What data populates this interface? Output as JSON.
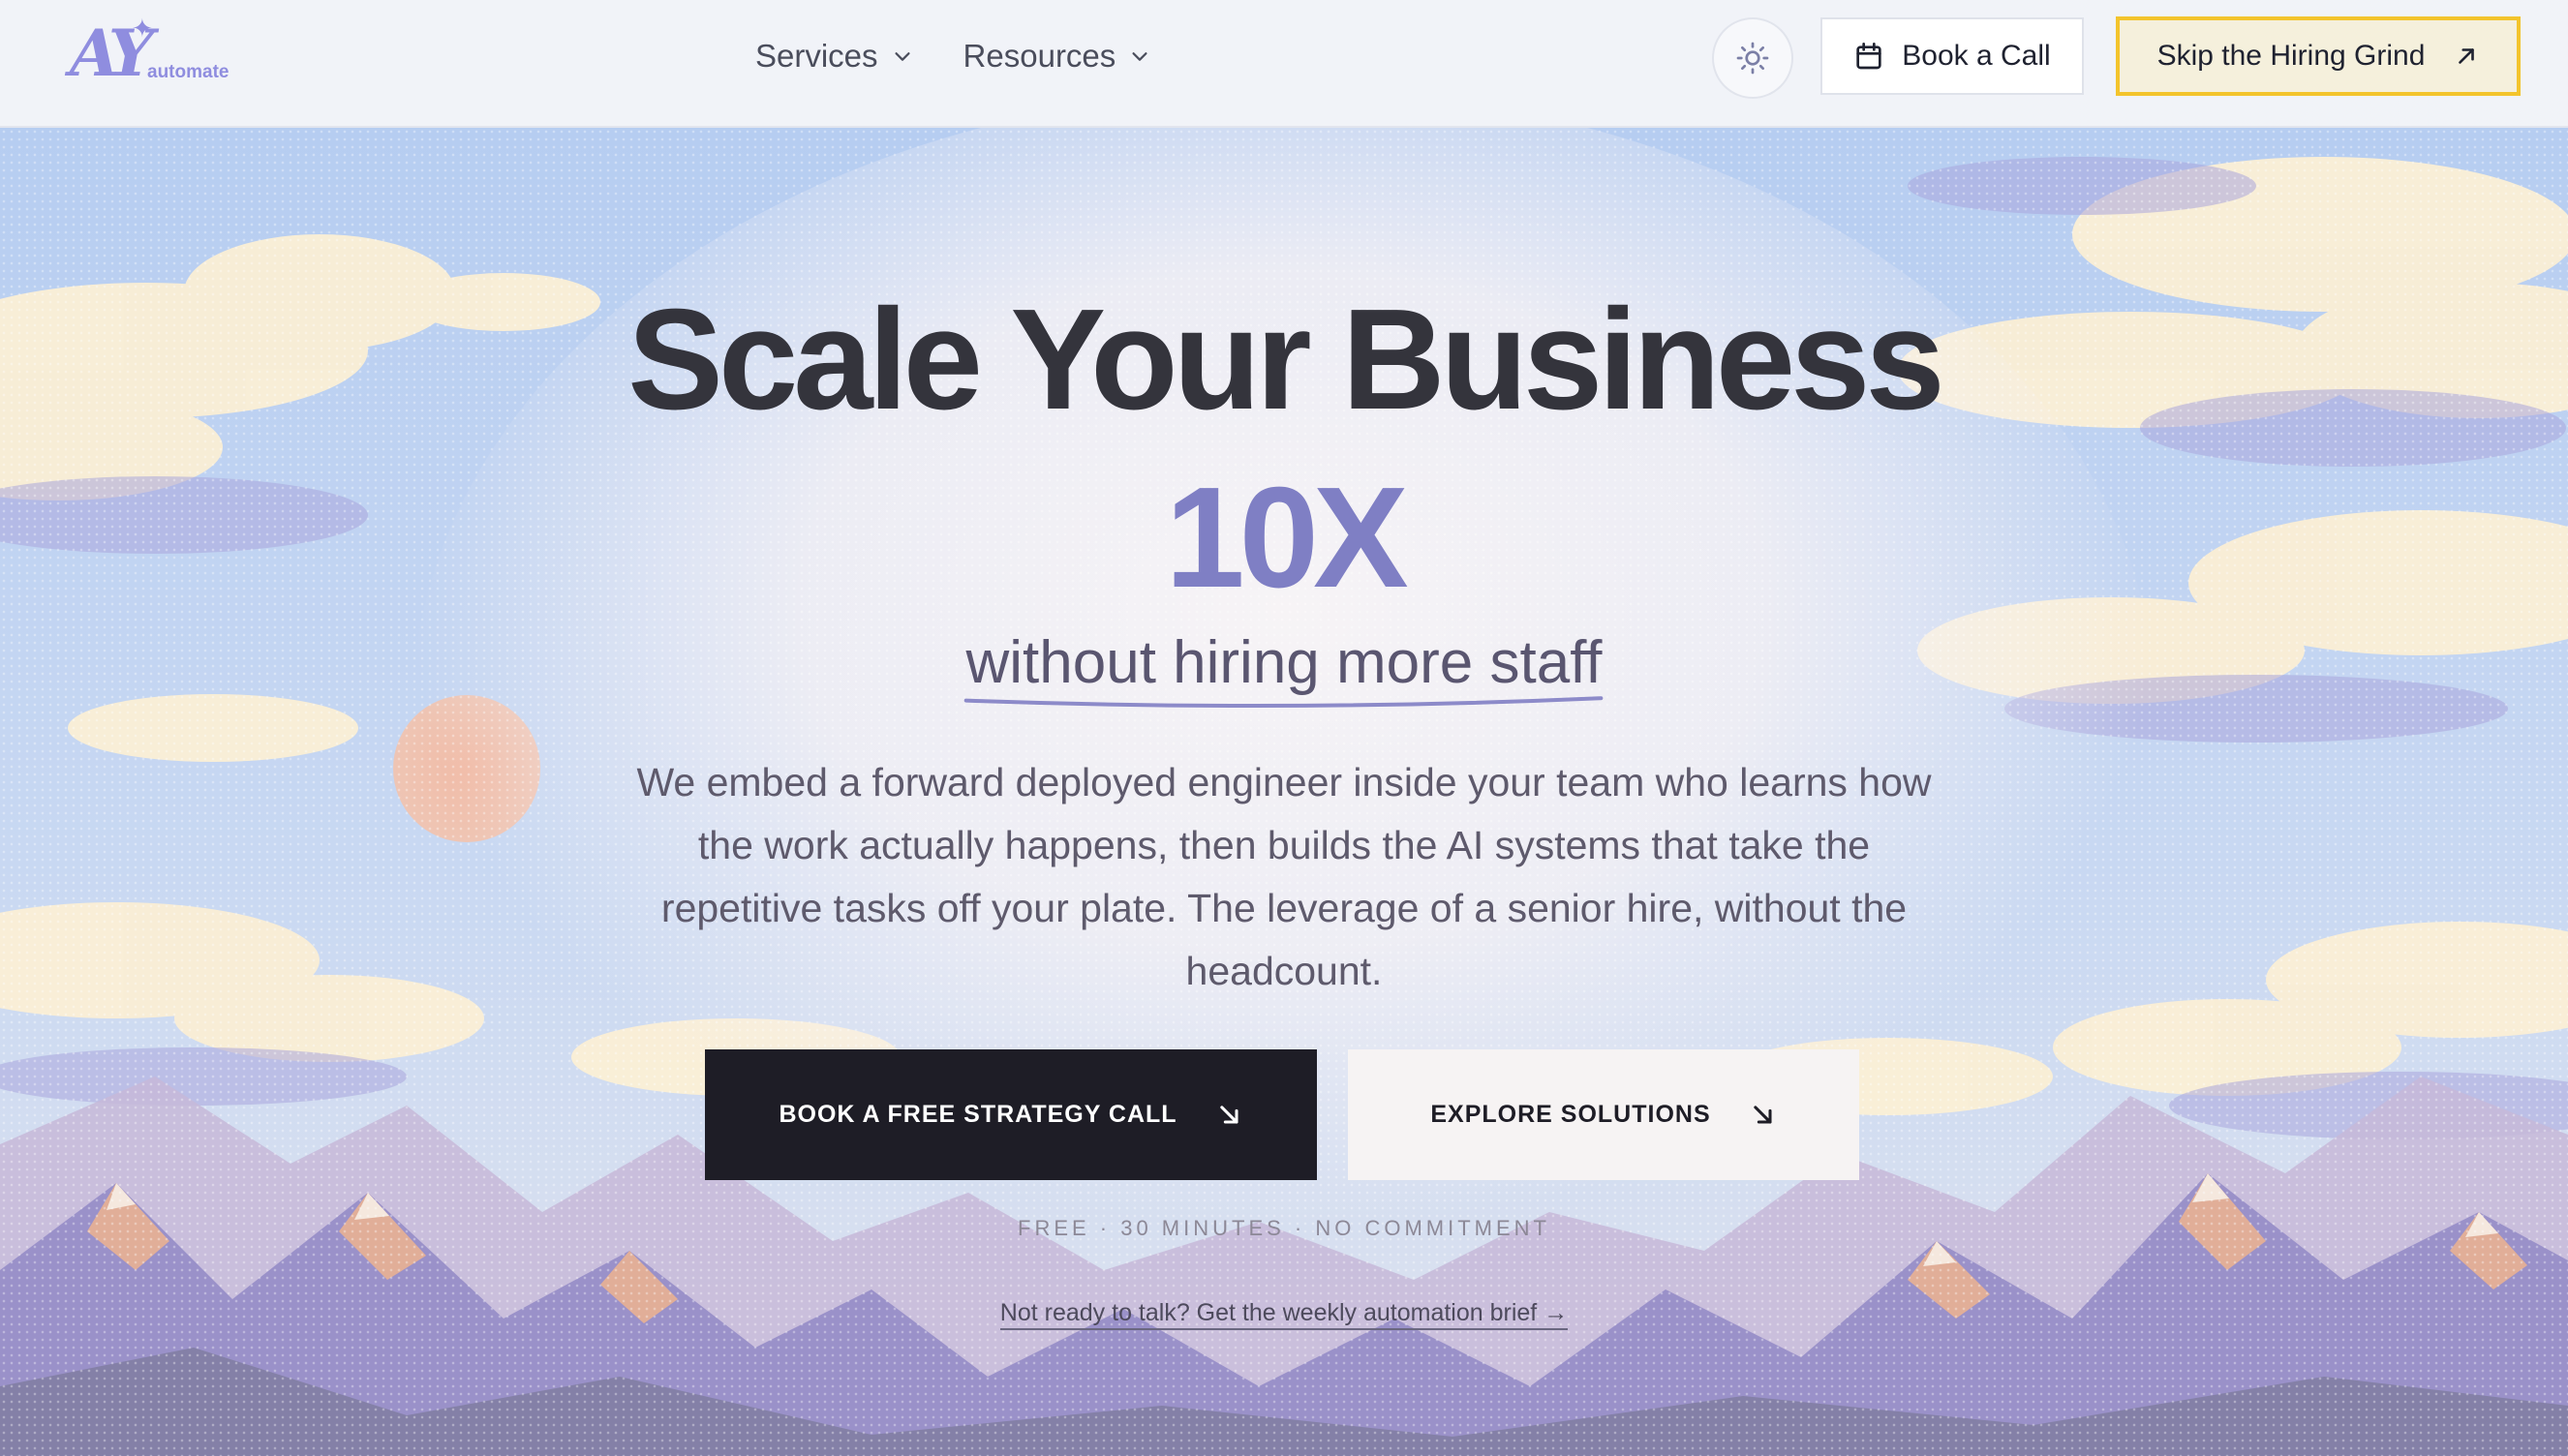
{
  "header": {
    "logo": {
      "mark": "AY",
      "word": "automate"
    },
    "nav": [
      {
        "label": "Services"
      },
      {
        "label": "Resources"
      }
    ],
    "theme_toggle_icon": "sun-icon",
    "book_call_label": "Book a Call",
    "skip_label": "Skip the Hiring Grind"
  },
  "hero": {
    "headline": "Scale Your Business",
    "highlight": "10X",
    "subline": "without hiring more staff",
    "description": "We embed a forward deployed engineer inside your team who learns how the work actually happens, then builds the AI systems that take the repetitive tasks off your plate. The leverage of a senior hire, without the headcount.",
    "cta_primary": "BOOK A FREE STRATEGY CALL",
    "cta_secondary": "EXPLORE SOLUTIONS",
    "note": "FREE · 30 MINUTES · NO COMMITMENT",
    "brief_link": "Not ready to talk? Get the weekly automation brief →"
  },
  "colors": {
    "accent": "#7f7fc4",
    "dark": "#1e1d26",
    "highlight_border": "#f3c42c",
    "sky": "#bcd1f2"
  }
}
